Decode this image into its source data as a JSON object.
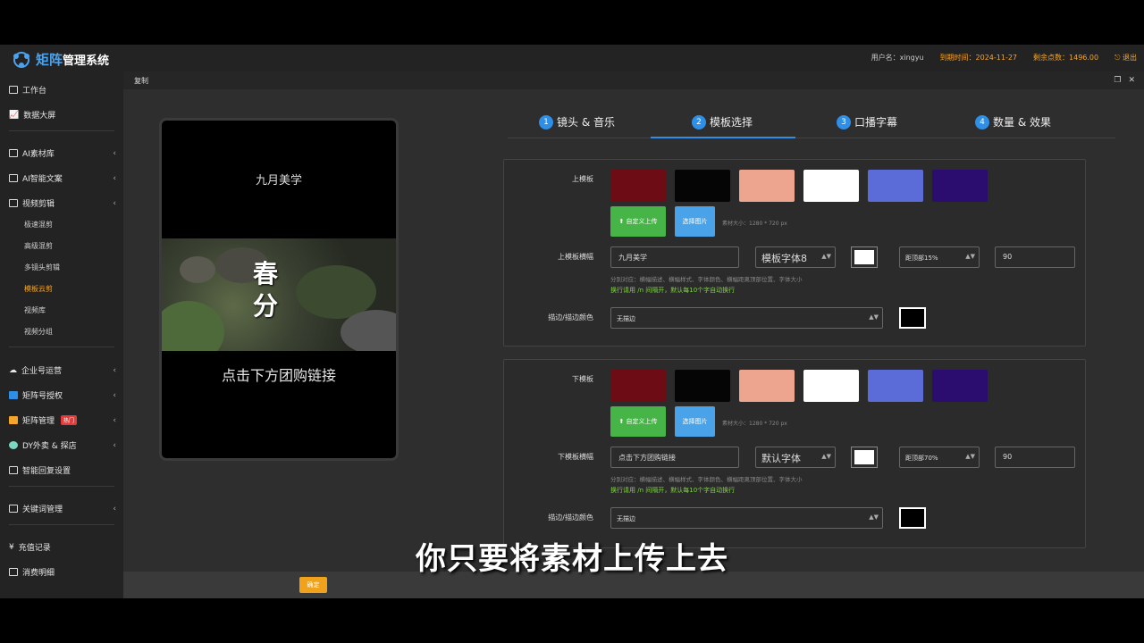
{
  "header": {
    "logo_big": "矩阵",
    "logo_small": "管理系统",
    "username": "用户名：xingyu",
    "expiry": "到期时间：2024-11-27",
    "points": "剩余点数：1496.00",
    "logout": "退出"
  },
  "sidebar": {
    "items": [
      {
        "label": "工作台"
      },
      {
        "label": "数据大屏"
      },
      {
        "label": "AI素材库"
      },
      {
        "label": "AI智能文案"
      },
      {
        "label": "视频剪辑"
      },
      {
        "label": "企业号运营"
      },
      {
        "label": "矩阵号授权"
      },
      {
        "label": "矩阵管理"
      },
      {
        "label": "DY外卖 & 探店"
      },
      {
        "label": "智能回复设置"
      },
      {
        "label": "关键词管理"
      },
      {
        "label": "充值记录"
      },
      {
        "label": "消费明细"
      }
    ],
    "sub_items": [
      "极速混剪",
      "高级混剪",
      "多镜头剪辑",
      "模板云剪",
      "视频库",
      "视频分组"
    ],
    "hot_badge": "热门"
  },
  "dialog": {
    "title": "复制",
    "preview": {
      "top_text": "九月美学",
      "image_text": "春\n分",
      "bottom_text": "点击下方团购链接"
    },
    "steps": [
      {
        "num": "1",
        "label": "镜头 & 音乐"
      },
      {
        "num": "2",
        "label": "模板选择"
      },
      {
        "num": "3",
        "label": "口播字幕"
      },
      {
        "num": "4",
        "label": "数量 & 效果"
      }
    ],
    "swatch_colors": [
      "#6e0c16",
      "#050505",
      "#eea590",
      "#ffffff",
      "#5b6cd8",
      "#2a0d6e"
    ],
    "top": {
      "template_label": "上模板",
      "custom_upload": "自定义上传",
      "choose_image": "选择图片",
      "size_hint": "素材大小：1280 * 720 px",
      "banner_label": "上模板横幅",
      "banner_text": "九月美学",
      "font": "模板字体8",
      "distance": "距顶部15%",
      "font_size": "90",
      "tip": "分别对应：横幅描述、横幅样式、字体颜色、横幅距离顶部位置、字体大小",
      "tip2": "换行请用 /n 间隔开，默认每10个字自动换行",
      "stroke_label": "描边/描边颜色",
      "stroke_value": "无描边"
    },
    "bottom": {
      "template_label": "下模板",
      "custom_upload": "自定义上传",
      "choose_image": "选择图片",
      "size_hint": "素材大小：1280 * 720 px",
      "banner_label": "下模板横幅",
      "banner_text": "点击下方团购链接",
      "font": "默认字体",
      "distance": "距顶部70%",
      "font_size": "90",
      "tip": "分别对应：横幅描述、横幅样式、字体颜色、横幅距离顶部位置、字体大小",
      "tip2": "换行请用 /n 间隔开，默认每10个字自动换行",
      "stroke_label": "描边/描边颜色",
      "stroke_value": "无描边"
    },
    "ok_label": "确定"
  },
  "video_subtitle": "你只要将素材上传上去"
}
